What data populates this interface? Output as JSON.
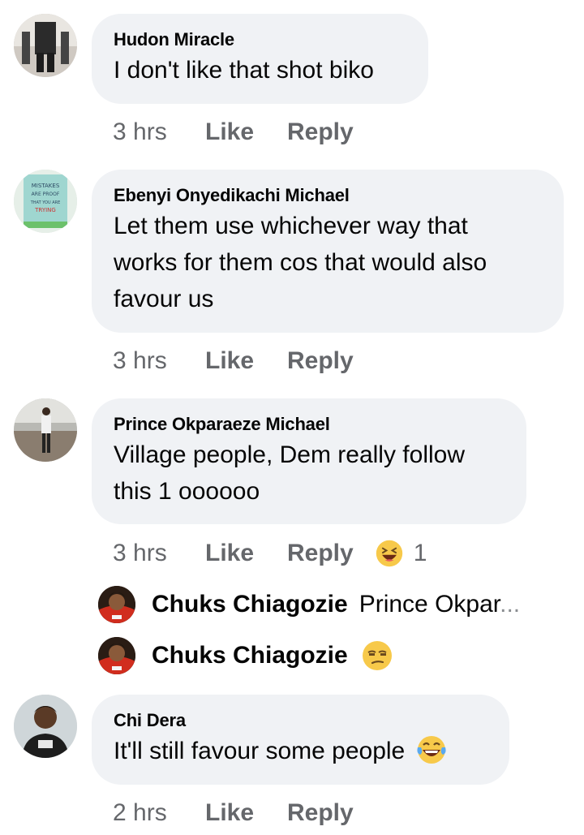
{
  "comments": [
    {
      "author": "Hudon Miracle",
      "text": "I don't like that shot biko",
      "time": "3 hrs",
      "like_label": "Like",
      "reply_label": "Reply"
    },
    {
      "author": "Ebenyi Onyedikachi Michael",
      "text_lines": [
        "Let them use whichever way that",
        "works for them cos that would also",
        "favour us"
      ],
      "avatar_text": [
        "MISTAKES",
        "ARE PROOF",
        "THAT YOU ARE",
        "TRYING"
      ],
      "time": "3 hrs",
      "like_label": "Like",
      "reply_label": "Reply"
    },
    {
      "author": "Prince Okparaeze Michael",
      "text_lines": [
        "Village people, Dem really follow",
        "this 1 oooooo"
      ],
      "time": "3 hrs",
      "like_label": "Like",
      "reply_label": "Reply",
      "reaction": {
        "icon": "laughing-emoji",
        "count": "1"
      },
      "replies": [
        {
          "author": "Chuks Chiagozie",
          "preview": "Prince Okpar",
          "ellipsis": "..."
        },
        {
          "author": "Chuks Chiagozie",
          "emoji": "unamused-face-emoji"
        }
      ]
    },
    {
      "author": "Chi Dera",
      "text": "It'll still favour some people",
      "emoji": "tears-of-joy-emoji",
      "time": "2 hrs",
      "like_label": "Like",
      "reply_label": "Reply"
    }
  ],
  "colors": {
    "bubble_bg": "#f0f2f5",
    "meta_text": "#65676b",
    "primary_text": "#050505"
  }
}
